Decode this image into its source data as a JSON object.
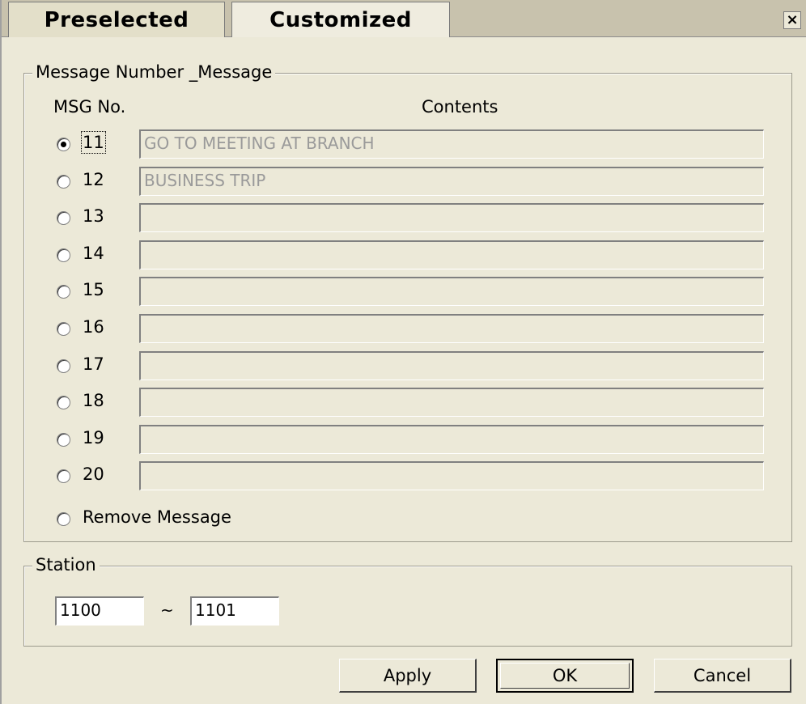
{
  "tabs": [
    {
      "label": "Preselected",
      "active": false
    },
    {
      "label": "Customized",
      "active": true
    }
  ],
  "close_label": "×",
  "message_group": {
    "legend": "Message Number _Message",
    "col_msgno": "MSG No.",
    "col_contents": "Contents",
    "rows": [
      {
        "number": "11",
        "content": "GO TO MEETING AT BRANCH",
        "selected": true
      },
      {
        "number": "12",
        "content": "BUSINESS TRIP",
        "selected": false
      },
      {
        "number": "13",
        "content": "",
        "selected": false
      },
      {
        "number": "14",
        "content": "",
        "selected": false
      },
      {
        "number": "15",
        "content": "",
        "selected": false
      },
      {
        "number": "16",
        "content": "",
        "selected": false
      },
      {
        "number": "17",
        "content": "",
        "selected": false
      },
      {
        "number": "18",
        "content": "",
        "selected": false
      },
      {
        "number": "19",
        "content": "",
        "selected": false
      },
      {
        "number": "20",
        "content": "",
        "selected": false
      }
    ],
    "remove_label": "Remove Message"
  },
  "station_group": {
    "legend": "Station",
    "from_value": "1100",
    "separator": "~",
    "to_value": "1101"
  },
  "buttons": {
    "apply": "Apply",
    "ok": "OK",
    "cancel": "Cancel"
  }
}
